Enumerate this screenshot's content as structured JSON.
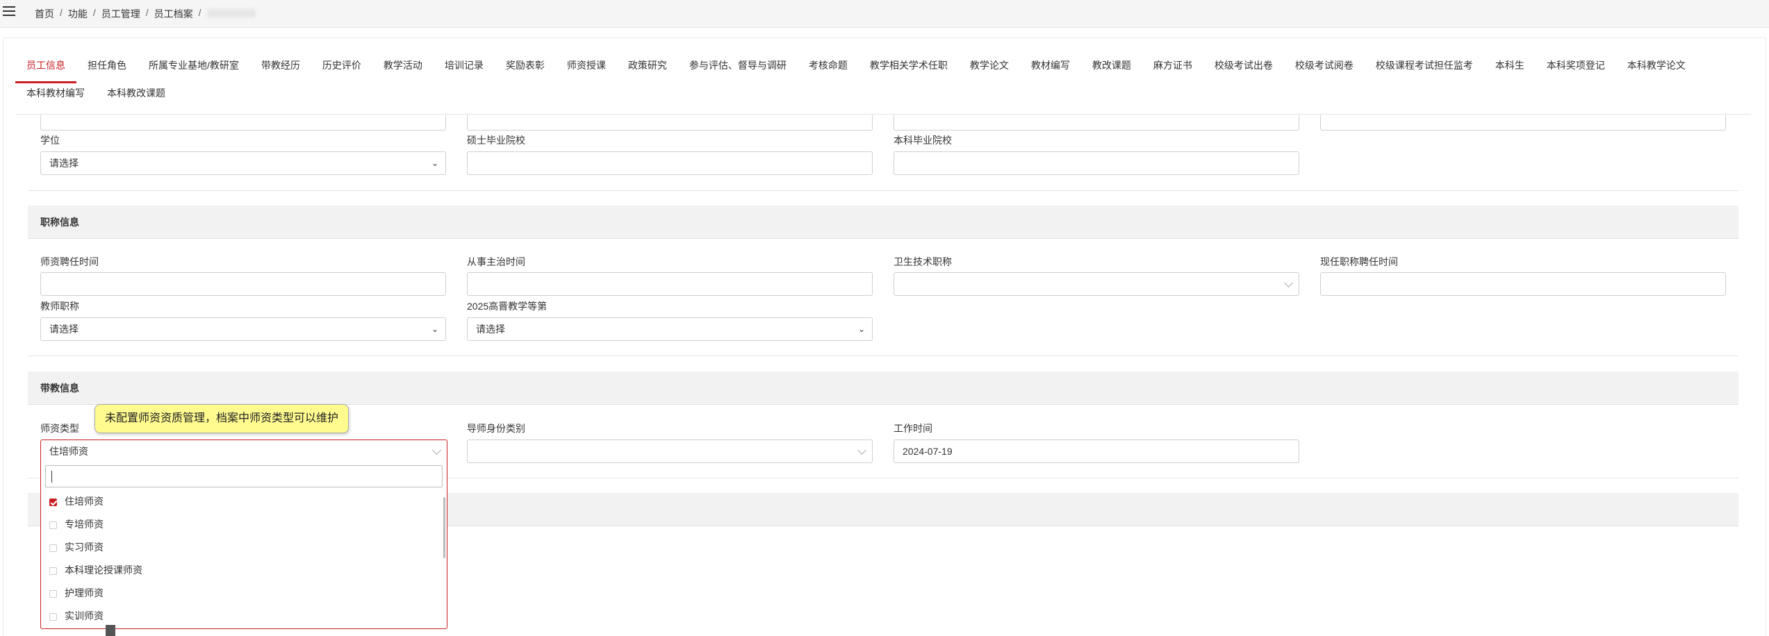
{
  "breadcrumb": {
    "items": [
      "首页",
      "功能",
      "员工管理",
      "员工档案"
    ],
    "separator": "/"
  },
  "tabs": {
    "row1": [
      "员工信息",
      "担任角色",
      "所属专业基地/教研室",
      "带教经历",
      "历史评价",
      "教学活动",
      "培训记录",
      "奖励表彰",
      "师资授课",
      "政策研究",
      "参与评估、督导与调研",
      "考核命题",
      "教学相关学术任职",
      "教学论文",
      "教材编写",
      "教改课题",
      "麻方证书",
      "校级考试出卷",
      "校级考试阅卷",
      "校级课程考试担任监考",
      "本科生",
      "本科奖项登记",
      "本科教学论文"
    ],
    "row2": [
      "本科教材编写",
      "本科教改课题"
    ],
    "active": "员工信息"
  },
  "education": {
    "degree_label": "学位",
    "degree_value": "请选择",
    "master_school_label": "硕士毕业院校",
    "master_school_value": "",
    "bachelor_school_label": "本科毕业院校",
    "bachelor_school_value": ""
  },
  "title_section": {
    "title": "职称信息",
    "teacher_hire_label": "师资聘任时间",
    "attending_time_label": "从事主治时间",
    "health_title_label": "卫生技术职称",
    "current_title_hire_label": "现任职称聘任时间",
    "teacher_title_label": "教师职称",
    "teacher_title_value": "请选择",
    "grade_label": "2025高晋教学等第",
    "grade_value": "请选择"
  },
  "teaching_section": {
    "title": "带教信息",
    "teacher_type_label": "师资类型",
    "teacher_type_value": "住培师资",
    "mentor_type_label": "导师身份类别",
    "work_time_label": "工作时间",
    "work_time_value": "2024-07-19"
  },
  "tooltip": "未配置师资资质管理，档案中师资类型可以维护",
  "dropdown": {
    "search_value": "",
    "options": [
      {
        "label": "住培师资",
        "checked": true
      },
      {
        "label": "专培师资",
        "checked": false
      },
      {
        "label": "实习师资",
        "checked": false
      },
      {
        "label": "本科理论授课师资",
        "checked": false
      },
      {
        "label": "护理师资",
        "checked": false
      },
      {
        "label": "实训师资",
        "checked": false
      }
    ]
  },
  "colors": {
    "accent": "#c81e23",
    "section_bg": "#f2f2f2",
    "tooltip_bg": "#fffb8f"
  }
}
